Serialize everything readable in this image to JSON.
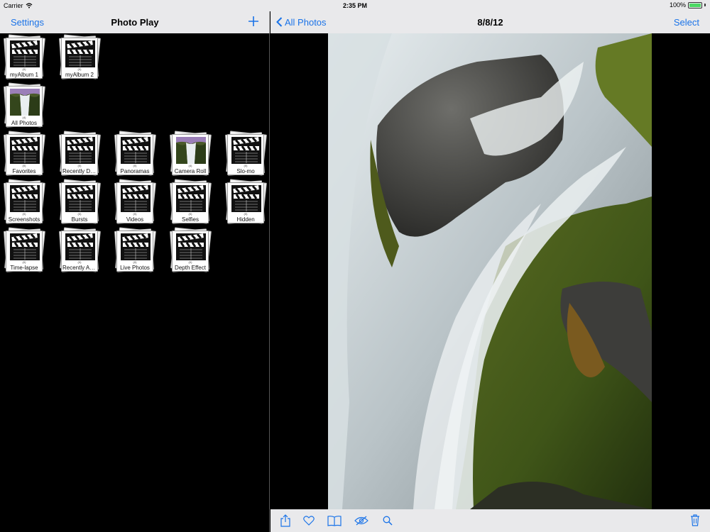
{
  "status": {
    "carrier": "Carrier",
    "time": "2:35 PM",
    "battery": "100%",
    "battery_level": 1.0
  },
  "left_nav": {
    "settings": "Settings",
    "title": "Photo Play"
  },
  "right_nav": {
    "back": "All Photos",
    "title": "8/8/12",
    "select": "Select"
  },
  "albums": [
    {
      "label": "myAlbum 1",
      "count": "(0)",
      "thumb": "clapperboard-icon"
    },
    {
      "label": "myAlbum 2",
      "count": "(0)",
      "thumb": "clapperboard-icon"
    },
    {
      "label": "All Photos",
      "count": "(4)",
      "thumb": "waterfall-photo"
    },
    {
      "label": "Favorites",
      "count": "(0)",
      "thumb": "clapperboard-icon"
    },
    {
      "label": "Recently De...",
      "count": "(0)",
      "thumb": "clapperboard-icon"
    },
    {
      "label": "Panoramas",
      "count": "(0)",
      "thumb": "clapperboard-icon"
    },
    {
      "label": "Camera Roll",
      "count": "(4)",
      "thumb": "waterfall-photo"
    },
    {
      "label": "Slo-mo",
      "count": "(0)",
      "thumb": "clapperboard-icon"
    },
    {
      "label": "Screenshots",
      "count": "(0)",
      "thumb": "clapperboard-icon"
    },
    {
      "label": "Bursts",
      "count": "(0)",
      "thumb": "clapperboard-icon"
    },
    {
      "label": "Videos",
      "count": "(0)",
      "thumb": "clapperboard-icon"
    },
    {
      "label": "Selfies",
      "count": "(0)",
      "thumb": "clapperboard-icon"
    },
    {
      "label": "Hidden",
      "count": "(0)",
      "thumb": "clapperboard-icon"
    },
    {
      "label": "Time-lapse",
      "count": "(0)",
      "thumb": "clapperboard-icon"
    },
    {
      "label": "Recently Ad...",
      "count": "(0)",
      "thumb": "clapperboard-icon"
    },
    {
      "label": "Live Photos",
      "count": "(0)",
      "thumb": "clapperboard-icon"
    },
    {
      "label": "Depth Effect",
      "count": "(0)",
      "thumb": "clapperboard-icon"
    }
  ],
  "toolbar": {
    "icons": [
      "share-icon",
      "heart-icon",
      "book-icon",
      "hide-eye-icon",
      "search-icon",
      "trash-icon"
    ]
  },
  "colors": {
    "accent": "#1a73e8",
    "bar": "#e9e9eb",
    "battery": "#4cd964"
  }
}
